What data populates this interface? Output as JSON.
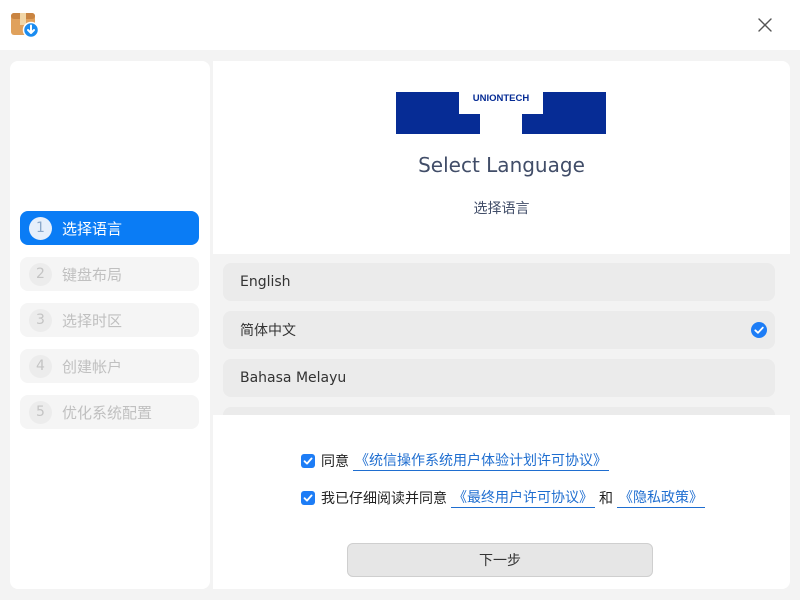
{
  "titlebar": {
    "app_icon": "package-download-icon",
    "close_icon": "close-icon"
  },
  "sidebar": {
    "steps": [
      {
        "number": "1",
        "label": "选择语言",
        "active": true
      },
      {
        "number": "2",
        "label": "键盘布局",
        "active": false
      },
      {
        "number": "3",
        "label": "选择时区",
        "active": false
      },
      {
        "number": "4",
        "label": "创建帐户",
        "active": false
      },
      {
        "number": "5",
        "label": "优化系统配置",
        "active": false
      }
    ]
  },
  "main": {
    "logo_text": "UNIONTECH",
    "title_en": "Select Language",
    "title_zh": "选择语言",
    "languages": [
      {
        "label": "English",
        "selected": false
      },
      {
        "label": "简体中文",
        "selected": true
      },
      {
        "label": "Bahasa Melayu",
        "selected": false
      }
    ],
    "agreements": {
      "row1": {
        "prefix": "同意",
        "link": "《统信操作系统用户体验计划许可协议》",
        "checked": true
      },
      "row2": {
        "prefix": "我已仔细阅读并同意",
        "link1": "《最终用户许可协议》",
        "conj": "和",
        "link2": "《隐私政策》",
        "checked": true
      }
    },
    "next_label": "下一步"
  },
  "colors": {
    "accent": "#0a7cf5",
    "logo_blue": "#062c95",
    "link": "#1f6ed0"
  }
}
